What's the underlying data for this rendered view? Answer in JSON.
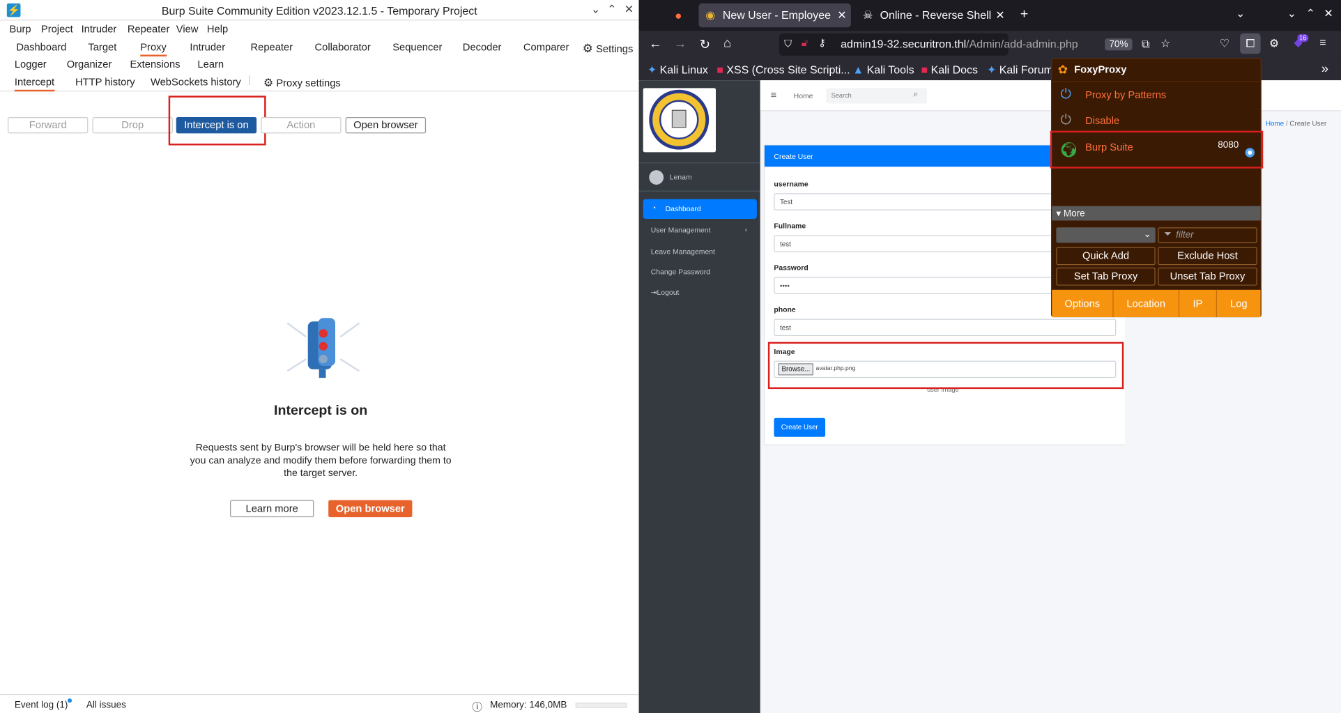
{
  "burp": {
    "title": "Burp Suite Community Edition v2023.12.1.5 - Temporary Project",
    "menu": [
      "Burp",
      "Project",
      "Intruder",
      "Repeater",
      "View",
      "Help"
    ],
    "tabs_row1": [
      "Dashboard",
      "Target",
      "Proxy",
      "Intruder",
      "Repeater",
      "Collaborator",
      "Sequencer",
      "Decoder",
      "Comparer",
      "Settings"
    ],
    "tabs_row2": [
      "Logger",
      "Organizer",
      "Extensions",
      "Learn"
    ],
    "proxy_tabs": [
      "Intercept",
      "HTTP history",
      "WebSockets history",
      "Proxy settings"
    ],
    "toolbar": {
      "forward": "Forward",
      "drop": "Drop",
      "intercept": "Intercept is on",
      "action": "Action",
      "open_browser": "Open browser"
    },
    "intercept": {
      "title": "Intercept is on",
      "description": "Requests sent by Burp's browser will be held here so that you can analyze and modify them before forwarding them to the target server.",
      "learn_more": "Learn more",
      "open_browser": "Open browser"
    },
    "status": {
      "event_log": "Event log (1)",
      "all_issues": "All issues",
      "memory": "Memory: 146,0MB"
    },
    "colors": {
      "accent": "#e8632b",
      "intercept_btn": "#1e5aa0",
      "highlight": "#d8201e"
    }
  },
  "firefox": {
    "tabs": [
      {
        "label": "New User - Employee M",
        "active": true
      },
      {
        "label": "Online - Reverse Shell G",
        "active": false
      }
    ],
    "url": "admin19-32.securitron.thl/Admin/add-admin.php",
    "url_host": "admin19-32.securitron.thl",
    "url_path": "/Admin/add-admin.php",
    "zoom": "70%",
    "ext_badge": "16",
    "bookmarks": [
      "Kali Linux",
      "XSS (Cross Site Scripti...",
      "Kali Tools",
      "Kali Docs",
      "Kali Forum"
    ]
  },
  "webpage": {
    "user": "Lenam",
    "sidebar": [
      "Dashboard",
      "User Management",
      "Leave Management",
      "Change Password",
      "Logout"
    ],
    "topnav": {
      "home": "Home",
      "search_placeholder": "Search"
    },
    "breadcrumb": {
      "home": "Home",
      "current": "Create User"
    },
    "card_title": "Create User",
    "form": {
      "username_label": "username",
      "username_value": "Test",
      "fullname_label": "Fullname",
      "fullname_value": "test",
      "password_label": "Password",
      "password_value": "••••",
      "phone_label": "phone",
      "phone_value": "test",
      "image_label": "Image",
      "browse_label": "Browse...",
      "file_value": "avatar.php.png",
      "image_hint": "user image",
      "submit": "Create User"
    }
  },
  "foxyproxy": {
    "title": "FoxyProxy",
    "items": [
      {
        "label": "Proxy by Patterns"
      },
      {
        "label": "Disable"
      },
      {
        "label": "Burp Suite",
        "port": "8080",
        "selected": true
      }
    ],
    "more": "More",
    "filter_placeholder": "filter",
    "buttons": [
      "Quick Add",
      "Exclude Host",
      "Set Tab Proxy",
      "Unset Tab Proxy"
    ],
    "bottom": [
      "Options",
      "Location",
      "IP",
      "Log"
    ],
    "colors": {
      "bg": "#3b1a04",
      "link": "#ff7139",
      "bottom": "#f7940f"
    }
  }
}
